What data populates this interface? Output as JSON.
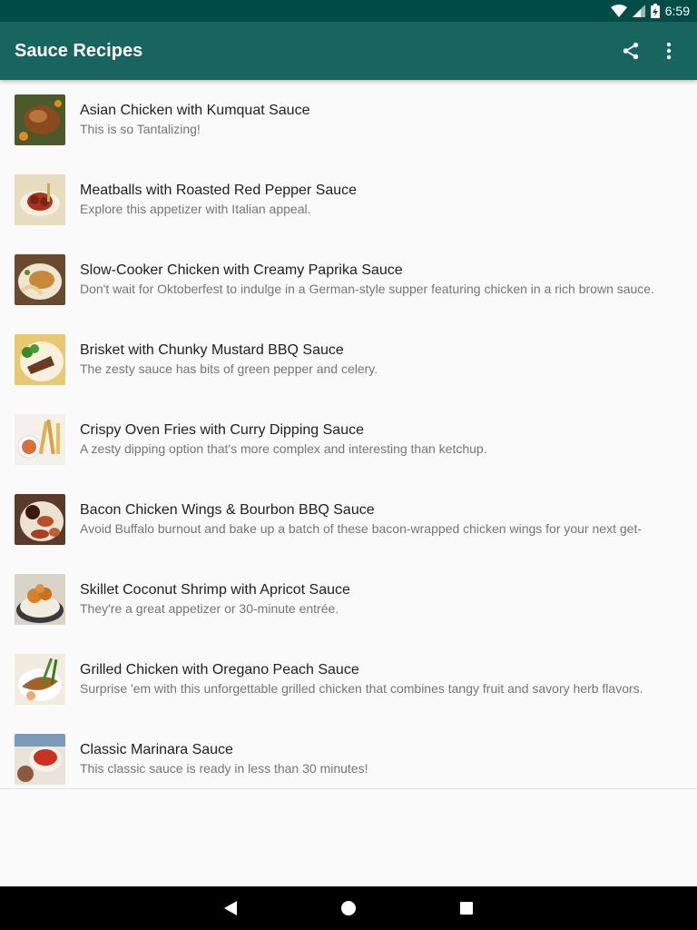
{
  "status_bar": {
    "time": "6:59",
    "icons": [
      "wifi-icon",
      "signal-icon",
      "battery-charging-icon"
    ]
  },
  "app_bar": {
    "title": "Sauce Recipes",
    "actions": [
      "share-icon",
      "more-vert-icon"
    ],
    "color": "#17655e"
  },
  "recipes": [
    {
      "title": "Asian Chicken with Kumquat Sauce",
      "subtitle": "This is so Tantalizing!"
    },
    {
      "title": "Meatballs with Roasted Red Pepper Sauce",
      "subtitle": "Explore this appetizer with Italian appeal."
    },
    {
      "title": "Slow-Cooker Chicken with Creamy Paprika Sauce",
      "subtitle": "Don't wait for Oktoberfest to indulge in a German-style supper featuring chicken in a rich brown sauce."
    },
    {
      "title": "Brisket with Chunky Mustard BBQ Sauce",
      "subtitle": "The zesty sauce has bits of green pepper and celery."
    },
    {
      "title": "Crispy Oven Fries with Curry Dipping Sauce",
      "subtitle": "A zesty dipping option that's more complex and interesting than ketchup."
    },
    {
      "title": "Bacon Chicken Wings & Bourbon BBQ Sauce",
      "subtitle": "Avoid Buffalo burnout and bake up a batch of these bacon-wrapped chicken wings for your next get-"
    },
    {
      "title": "Skillet Coconut Shrimp with Apricot Sauce",
      "subtitle": "They're a great appetizer or 30-minute entrée."
    },
    {
      "title": "Grilled Chicken with Oregano Peach Sauce",
      "subtitle": "Surprise 'em with this unforgettable grilled chicken that combines tangy fruit and savory herb flavors."
    },
    {
      "title": "Classic Marinara Sauce",
      "subtitle": "This classic sauce is ready in less than 30 minutes!"
    }
  ],
  "nav_bar": {
    "buttons": [
      "back-icon",
      "home-icon",
      "recents-icon"
    ]
  }
}
